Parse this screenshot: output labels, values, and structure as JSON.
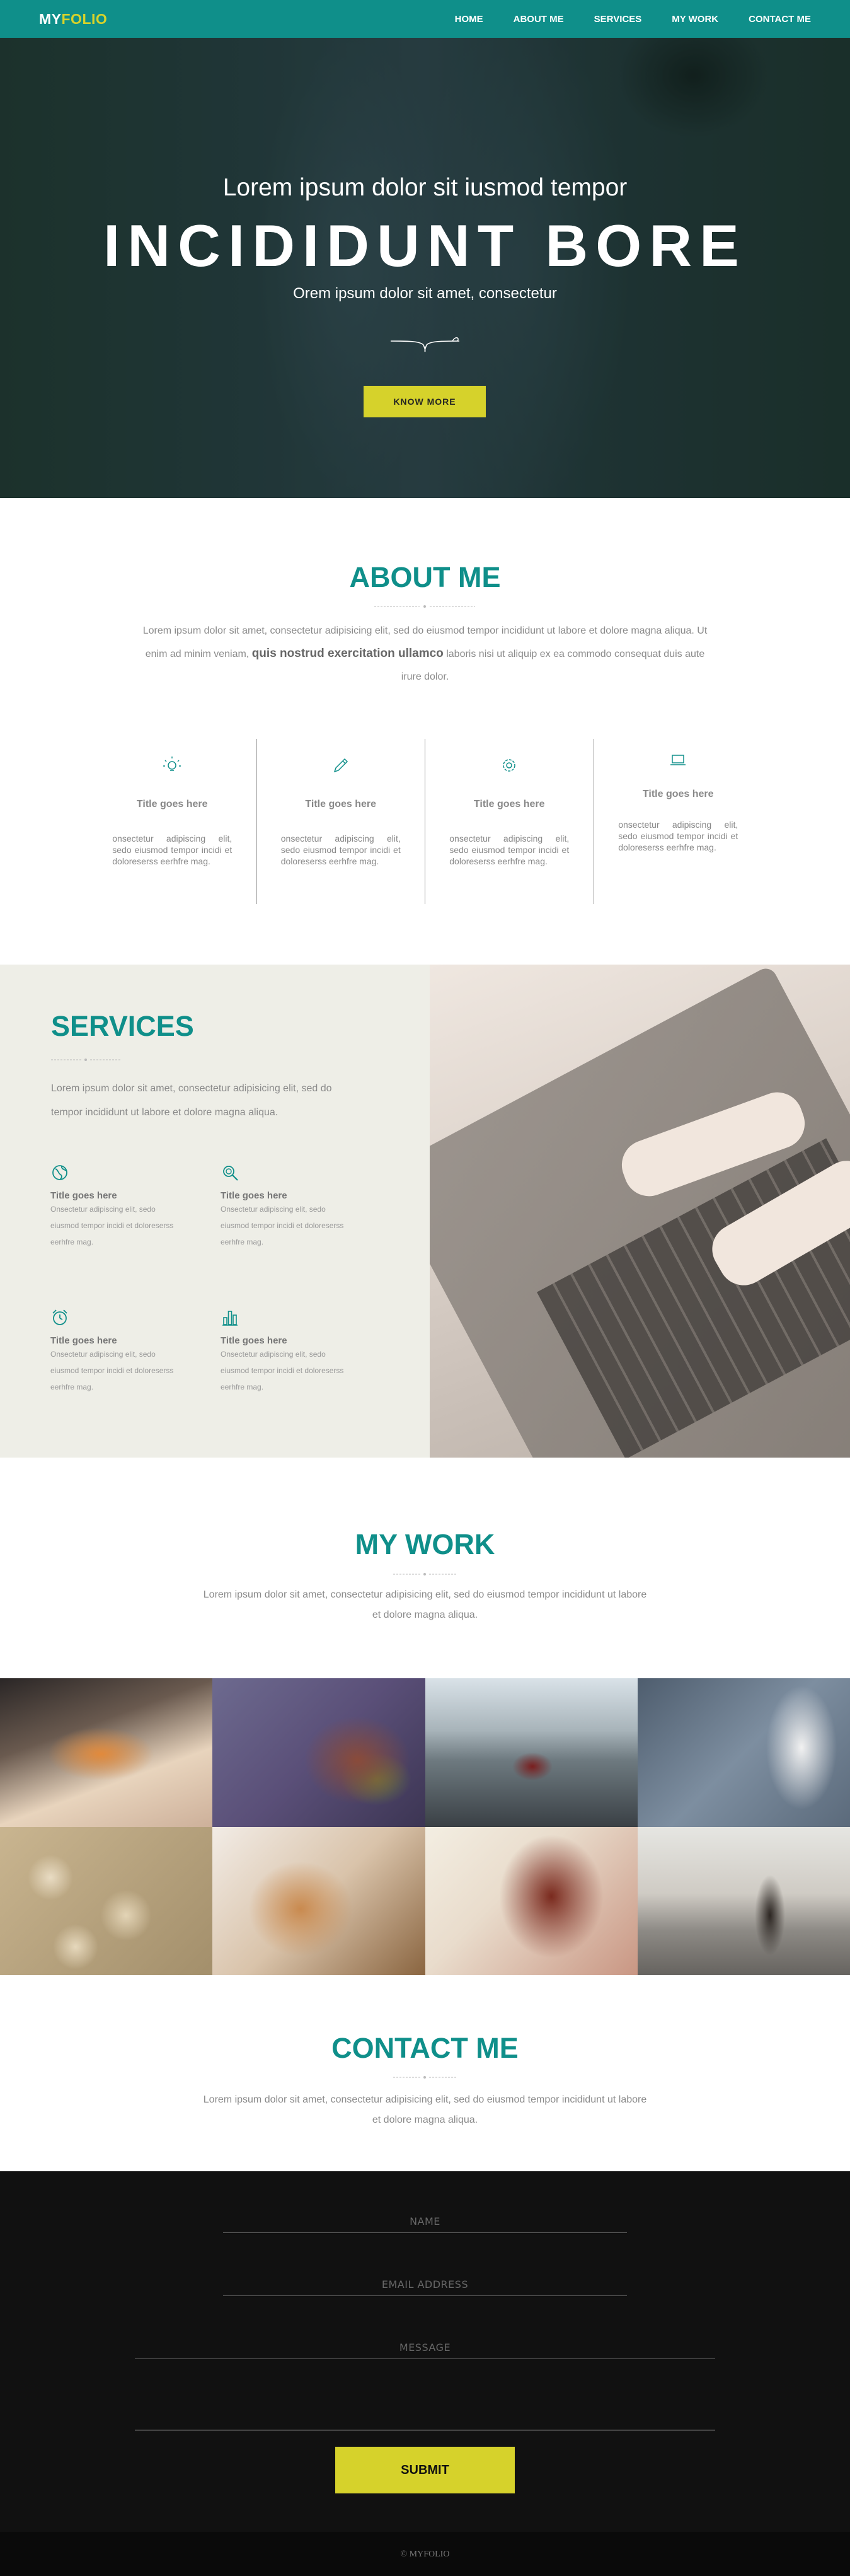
{
  "nav": {
    "logo_my": "MY",
    "logo_folio": "FOLIO",
    "items": [
      {
        "label": "HOME"
      },
      {
        "label": "ABOUT ME"
      },
      {
        "label": "SERVICES"
      },
      {
        "label": "MY WORK"
      },
      {
        "label": "CONTACT ME"
      }
    ]
  },
  "hero": {
    "subtitle": "Lorem ipsum dolor sit iusmod tempor",
    "title": "INCIDIDUNT BORE",
    "tagline": "Orem ipsum dolor sit amet, consectetur",
    "button": "KNOW MORE"
  },
  "about": {
    "title": "ABOUT ME",
    "text_before": "Lorem ipsum dolor sit amet, consectetur adipisicing elit, sed do eiusmod tempor incididunt ut labore et dolore magna aliqua. Ut enim ad minim veniam, ",
    "text_bold": "quis nostrud exercitation ullamco",
    "text_after": " laboris nisi ut aliquip ex ea commodo consequat duis aute irure dolor.",
    "features": [
      {
        "icon": "lightbulb-icon",
        "title": "Title goes here",
        "text": "onsectetur adipiscing elit, sedo eiusmod tempor incidi et doloreserss eerhfre mag."
      },
      {
        "icon": "pencil-icon",
        "title": "Title goes here",
        "text": "onsectetur adipiscing elit, sedo eiusmod tempor incidi et doloreserss eerhfre mag."
      },
      {
        "icon": "gear-icon",
        "title": "Title goes here",
        "text": "onsectetur adipiscing elit, sedo eiusmod tempor incidi et doloreserss eerhfre mag."
      },
      {
        "icon": "laptop-icon",
        "title": "Title goes here",
        "text": "onsectetur adipiscing elit, sedo eiusmod tempor incidi et doloreserss eerhfre mag."
      }
    ]
  },
  "services": {
    "title": "SERVICES",
    "text": "Lorem ipsum dolor sit amet, consectetur adipisicing elit, sed do tempor incididunt ut labore et dolore magna aliqua.",
    "items": [
      {
        "icon": "globe-icon",
        "title": "Title goes here",
        "text": "Onsectetur adipiscing elit, sedo eiusmod tempor incidi et doloreserss eerhfre mag."
      },
      {
        "icon": "search-icon",
        "title": "Title goes here",
        "text": "Onsectetur adipiscing elit, sedo eiusmod tempor incidi et doloreserss eerhfre mag."
      },
      {
        "icon": "alarm-clock-icon",
        "title": "Title goes here",
        "text": "Onsectetur adipiscing elit, sedo eiusmod tempor incidi et doloreserss eerhfre mag."
      },
      {
        "icon": "bar-chart-icon",
        "title": "Title goes here",
        "text": "Onsectetur adipiscing elit, sedo eiusmod tempor incidi et doloreserss eerhfre mag."
      }
    ]
  },
  "work": {
    "title": "MY WORK",
    "text": "Lorem ipsum dolor sit amet, consectetur adipisicing elit, sed do eiusmod tempor incididunt ut labore et dolore magna aliqua.",
    "tiles": [
      "sunglasses-photo",
      "autumn-leaf-photo",
      "car-on-road-photo",
      "swan-photo",
      "banana-slices-photo",
      "puppy-photo",
      "red-hair-photo",
      "street-walker-photo"
    ]
  },
  "contact": {
    "title": "CONTACT ME",
    "text": "Lorem ipsum dolor sit amet, consectetur adipisicing elit, sed do eiusmod tempor incididunt ut labore et dolore magna aliqua.",
    "name_placeholder": "NAME",
    "email_placeholder": "EMAIL ADDRESS",
    "message_placeholder": "MESSAGE",
    "submit": "SUBMIT"
  },
  "footer": {
    "copyright": "© MYFOLIO"
  },
  "colors": {
    "primary": "#0f8f8a",
    "accent": "#d6d22b",
    "dark": "#111111"
  }
}
